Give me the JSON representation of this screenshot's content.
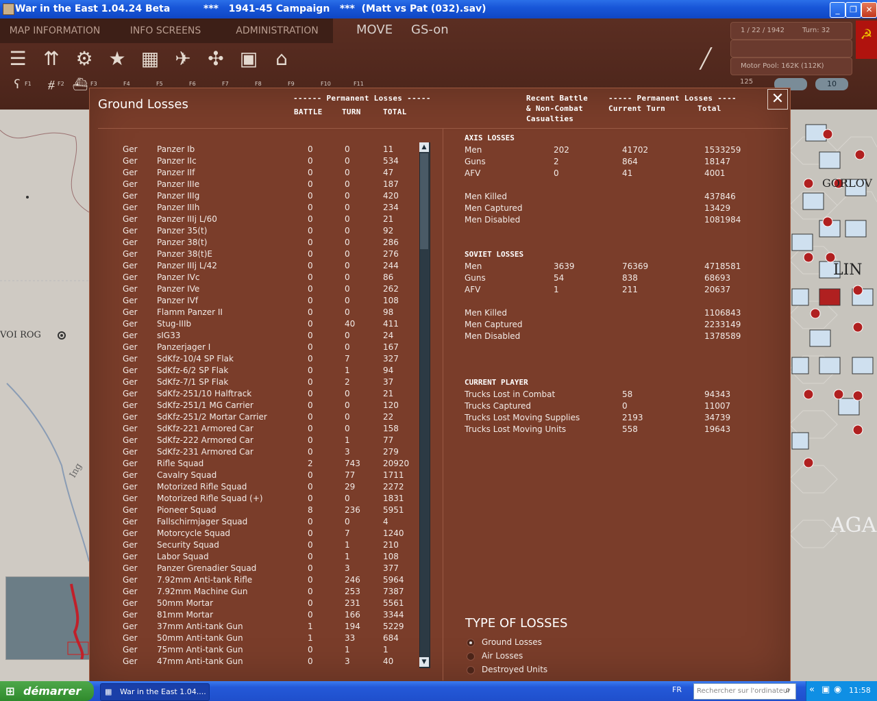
{
  "window": {
    "title": "War in the East 1.04.24 Beta          ***   1941-45 Campaign   ***  (Matt vs Pat (032).sav)"
  },
  "menu": {
    "map_information": "MAP INFORMATION",
    "info_screens": "INFO SCREENS",
    "administration": "ADMINISTRATION",
    "move": "MOVE",
    "gs": "GS-on"
  },
  "status": {
    "date": "1 / 22 / 1942",
    "turn": "Turn: 32",
    "motor_pool": "Motor Pool: 162K (112K)",
    "count": "125",
    "zoom": "10"
  },
  "function_keys": [
    "F1",
    "F2",
    "F3",
    "F4",
    "F5",
    "F6",
    "F7",
    "F8",
    "F9",
    "F10",
    "F11"
  ],
  "map_labels": {
    "voi_rog": "VOI ROG",
    "gorlov": "GORLOV",
    "lin": "LIN",
    "agan": "AGAN",
    "ing": "Ing"
  },
  "panel": {
    "title": "Ground Losses",
    "perm_losses_header": "------ Permanent Losses -----",
    "col_battle": "BATTLE",
    "col_turn": "TURN",
    "col_total": "TOTAL",
    "recent_header_1": "Recent Battle",
    "recent_header_2": "& Non-Combat",
    "recent_header_3": "Casualties",
    "perm_right_header": "----- Permanent Losses ----",
    "current_turn": "Current Turn",
    "total": "Total",
    "close": "✕"
  },
  "rows": [
    {
      "nat": "Ger",
      "name": "Panzer Ib",
      "battle": "0",
      "turn": "0",
      "total": "11"
    },
    {
      "nat": "Ger",
      "name": "Panzer IIc",
      "battle": "0",
      "turn": "0",
      "total": "534"
    },
    {
      "nat": "Ger",
      "name": "Panzer IIf",
      "battle": "0",
      "turn": "0",
      "total": "47"
    },
    {
      "nat": "Ger",
      "name": "Panzer IIIe",
      "battle": "0",
      "turn": "0",
      "total": "187"
    },
    {
      "nat": "Ger",
      "name": "Panzer IIIg",
      "battle": "0",
      "turn": "0",
      "total": "420"
    },
    {
      "nat": "Ger",
      "name": "Panzer IIIh",
      "battle": "0",
      "turn": "0",
      "total": "234"
    },
    {
      "nat": "Ger",
      "name": "Panzer IIIj L/60",
      "battle": "0",
      "turn": "0",
      "total": "21"
    },
    {
      "nat": "Ger",
      "name": "Panzer 35(t)",
      "battle": "0",
      "turn": "0",
      "total": "92"
    },
    {
      "nat": "Ger",
      "name": "Panzer 38(t)",
      "battle": "0",
      "turn": "0",
      "total": "286"
    },
    {
      "nat": "Ger",
      "name": "Panzer 38(t)E",
      "battle": "0",
      "turn": "0",
      "total": "276"
    },
    {
      "nat": "Ger",
      "name": "Panzer IIIj L/42",
      "battle": "0",
      "turn": "0",
      "total": "244"
    },
    {
      "nat": "Ger",
      "name": "Panzer IVc",
      "battle": "0",
      "turn": "0",
      "total": "86"
    },
    {
      "nat": "Ger",
      "name": "Panzer IVe",
      "battle": "0",
      "turn": "0",
      "total": "262"
    },
    {
      "nat": "Ger",
      "name": "Panzer IVf",
      "battle": "0",
      "turn": "0",
      "total": "108"
    },
    {
      "nat": "Ger",
      "name": "Flamm Panzer II",
      "battle": "0",
      "turn": "0",
      "total": "98"
    },
    {
      "nat": "Ger",
      "name": "Stug-IIIb",
      "battle": "0",
      "turn": "40",
      "total": "411"
    },
    {
      "nat": "Ger",
      "name": "sIG33",
      "battle": "0",
      "turn": "0",
      "total": "24"
    },
    {
      "nat": "Ger",
      "name": "Panzerjager I",
      "battle": "0",
      "turn": "0",
      "total": "167"
    },
    {
      "nat": "Ger",
      "name": "SdKfz-10/4 SP Flak",
      "battle": "0",
      "turn": "7",
      "total": "327"
    },
    {
      "nat": "Ger",
      "name": "SdKfz-6/2 SP Flak",
      "battle": "0",
      "turn": "1",
      "total": "94"
    },
    {
      "nat": "Ger",
      "name": "SdKfz-7/1 SP Flak",
      "battle": "0",
      "turn": "2",
      "total": "37"
    },
    {
      "nat": "Ger",
      "name": "SdKfz-251/10 Halftrack",
      "battle": "0",
      "turn": "0",
      "total": "21"
    },
    {
      "nat": "Ger",
      "name": "SdKfz-251/1 MG Carrier",
      "battle": "0",
      "turn": "0",
      "total": "120"
    },
    {
      "nat": "Ger",
      "name": "SdKfz-251/2 Mortar Carrier",
      "battle": "0",
      "turn": "0",
      "total": "22"
    },
    {
      "nat": "Ger",
      "name": "SdKfz-221 Armored Car",
      "battle": "0",
      "turn": "0",
      "total": "158"
    },
    {
      "nat": "Ger",
      "name": "SdKfz-222 Armored Car",
      "battle": "0",
      "turn": "1",
      "total": "77"
    },
    {
      "nat": "Ger",
      "name": "SdKfz-231 Armored Car",
      "battle": "0",
      "turn": "3",
      "total": "279"
    },
    {
      "nat": "Ger",
      "name": "Rifle Squad",
      "battle": "2",
      "turn": "743",
      "total": "20920"
    },
    {
      "nat": "Ger",
      "name": "Cavalry Squad",
      "battle": "0",
      "turn": "77",
      "total": "1711"
    },
    {
      "nat": "Ger",
      "name": "Motorized Rifle Squad",
      "battle": "0",
      "turn": "29",
      "total": "2272"
    },
    {
      "nat": "Ger",
      "name": "Motorized Rifle Squad (+)",
      "battle": "0",
      "turn": "0",
      "total": "1831"
    },
    {
      "nat": "Ger",
      "name": "Pioneer Squad",
      "battle": "8",
      "turn": "236",
      "total": "5951"
    },
    {
      "nat": "Ger",
      "name": "Fallschirmjager Squad",
      "battle": "0",
      "turn": "0",
      "total": "4"
    },
    {
      "nat": "Ger",
      "name": "Motorcycle Squad",
      "battle": "0",
      "turn": "7",
      "total": "1240"
    },
    {
      "nat": "Ger",
      "name": "Security Squad",
      "battle": "0",
      "turn": "1",
      "total": "210"
    },
    {
      "nat": "Ger",
      "name": "Labor Squad",
      "battle": "0",
      "turn": "1",
      "total": "108"
    },
    {
      "nat": "Ger",
      "name": "Panzer Grenadier Squad",
      "battle": "0",
      "turn": "3",
      "total": "377"
    },
    {
      "nat": "Ger",
      "name": "7.92mm Anti-tank Rifle",
      "battle": "0",
      "turn": "246",
      "total": "5964"
    },
    {
      "nat": "Ger",
      "name": "7.92mm Machine Gun",
      "battle": "0",
      "turn": "253",
      "total": "7387"
    },
    {
      "nat": "Ger",
      "name": "50mm Mortar",
      "battle": "0",
      "turn": "231",
      "total": "5561"
    },
    {
      "nat": "Ger",
      "name": "81mm Mortar",
      "battle": "0",
      "turn": "166",
      "total": "3344"
    },
    {
      "nat": "Ger",
      "name": "37mm Anti-tank Gun",
      "battle": "1",
      "turn": "194",
      "total": "5229"
    },
    {
      "nat": "Ger",
      "name": "50mm Anti-tank Gun",
      "battle": "1",
      "turn": "33",
      "total": "684"
    },
    {
      "nat": "Ger",
      "name": "75mm Anti-tank Gun",
      "battle": "0",
      "turn": "1",
      "total": "1"
    },
    {
      "nat": "Ger",
      "name": "47mm Anti-tank Gun",
      "battle": "0",
      "turn": "3",
      "total": "40"
    }
  ],
  "axis": {
    "title": "AXIS LOSSES",
    "rows": [
      {
        "label": "Men",
        "recent": "202",
        "turn": "41702",
        "total": "1533259"
      },
      {
        "label": "Guns",
        "recent": "2",
        "turn": "864",
        "total": "18147"
      },
      {
        "label": "AFV",
        "recent": "0",
        "turn": "41",
        "total": "4001"
      }
    ],
    "killed_label": "Men Killed",
    "killed": "437846",
    "captured_label": "Men Captured",
    "captured": "13429",
    "disabled_label": "Men Disabled",
    "disabled": "1081984"
  },
  "soviet": {
    "title": "SOVIET LOSSES",
    "rows": [
      {
        "label": "Men",
        "recent": "3639",
        "turn": "76369",
        "total": "4718581"
      },
      {
        "label": "Guns",
        "recent": "54",
        "turn": "838",
        "total": "68693"
      },
      {
        "label": "AFV",
        "recent": "1",
        "turn": "211",
        "total": "20637"
      }
    ],
    "killed_label": "Men Killed",
    "killed": "1106843",
    "captured_label": "Men Captured",
    "captured": "2233149",
    "disabled_label": "Men Disabled",
    "disabled": "1378589"
  },
  "player": {
    "title": "CURRENT PLAYER",
    "rows": [
      {
        "label": "Trucks Lost in Combat",
        "turn": "58",
        "total": "94343"
      },
      {
        "label": "Trucks Captured",
        "turn": "0",
        "total": "11007"
      },
      {
        "label": "Trucks Lost Moving Supplies",
        "turn": "2193",
        "total": "34739"
      },
      {
        "label": "Trucks Lost Moving Units",
        "turn": "558",
        "total": "19643"
      }
    ]
  },
  "loss_types": {
    "title": "TYPE OF LOSSES",
    "options": [
      "Ground Losses",
      "Air Losses",
      "Destroyed Units"
    ],
    "selected": "Ground Losses"
  },
  "taskbar": {
    "start": "démarrer",
    "task": "War in the East 1.04....",
    "lang": "FR",
    "search_placeholder": "Rechercher sur l'ordinateur",
    "clock": "11:58"
  },
  "colors": {
    "panel_bg": "#7a3d2a",
    "menu_bg": "#3d1f17",
    "titlebar": "#1856d8",
    "taskbar": "#2459d8",
    "start_green": "#3a9a36"
  }
}
